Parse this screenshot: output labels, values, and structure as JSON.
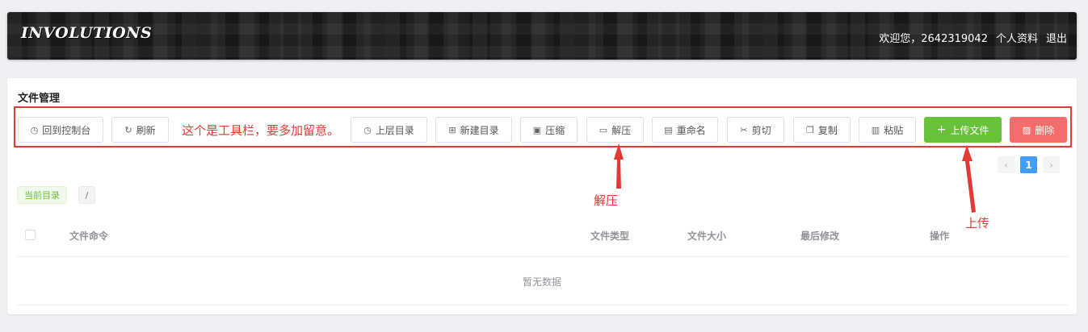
{
  "header": {
    "logo_text": "INVOLUTIONS",
    "welcome": "欢迎您，2642319042",
    "profile_link": "个人资料",
    "logout_link": "退出",
    "background": "#202020"
  },
  "card": {
    "title": "文件管理"
  },
  "toolbar": {
    "note": "这个是工具栏，要多加留意。",
    "buttons": {
      "back_console": "回到控制台",
      "refresh": "刷新",
      "parent_dir": "上层目录",
      "new_dir": "新建目录",
      "compress": "压缩",
      "extract": "解压",
      "rename": "重命名",
      "cut": "剪切",
      "copy": "复制",
      "paste": "粘贴",
      "upload": "上传文件",
      "delete": "删除"
    },
    "colors": {
      "upload": "#67c23a",
      "delete": "#f56c6c",
      "annotation": "#e53935"
    },
    "icons": {
      "back_console": "clock-icon",
      "refresh": "refresh-icon",
      "parent_dir": "clock-icon",
      "new_dir": "folder-add-icon",
      "compress": "box-icon",
      "extract": "box-open-icon",
      "rename": "document-icon",
      "cut": "scissors-icon",
      "copy": "copy-icon",
      "paste": "paste-icon",
      "upload": "plus-icon",
      "delete": "delete-document-icon"
    }
  },
  "pagination": {
    "prev": "‹",
    "current_page": "1",
    "next": "›"
  },
  "current_dir": {
    "label": "当前目录",
    "path": "/"
  },
  "table": {
    "columns": [
      "文件命令",
      "文件类型",
      "文件大小",
      "最后修改",
      "操作"
    ],
    "empty_text": "暂无数据"
  },
  "annotations": {
    "extract_label": "解压",
    "upload_label": "上传"
  }
}
